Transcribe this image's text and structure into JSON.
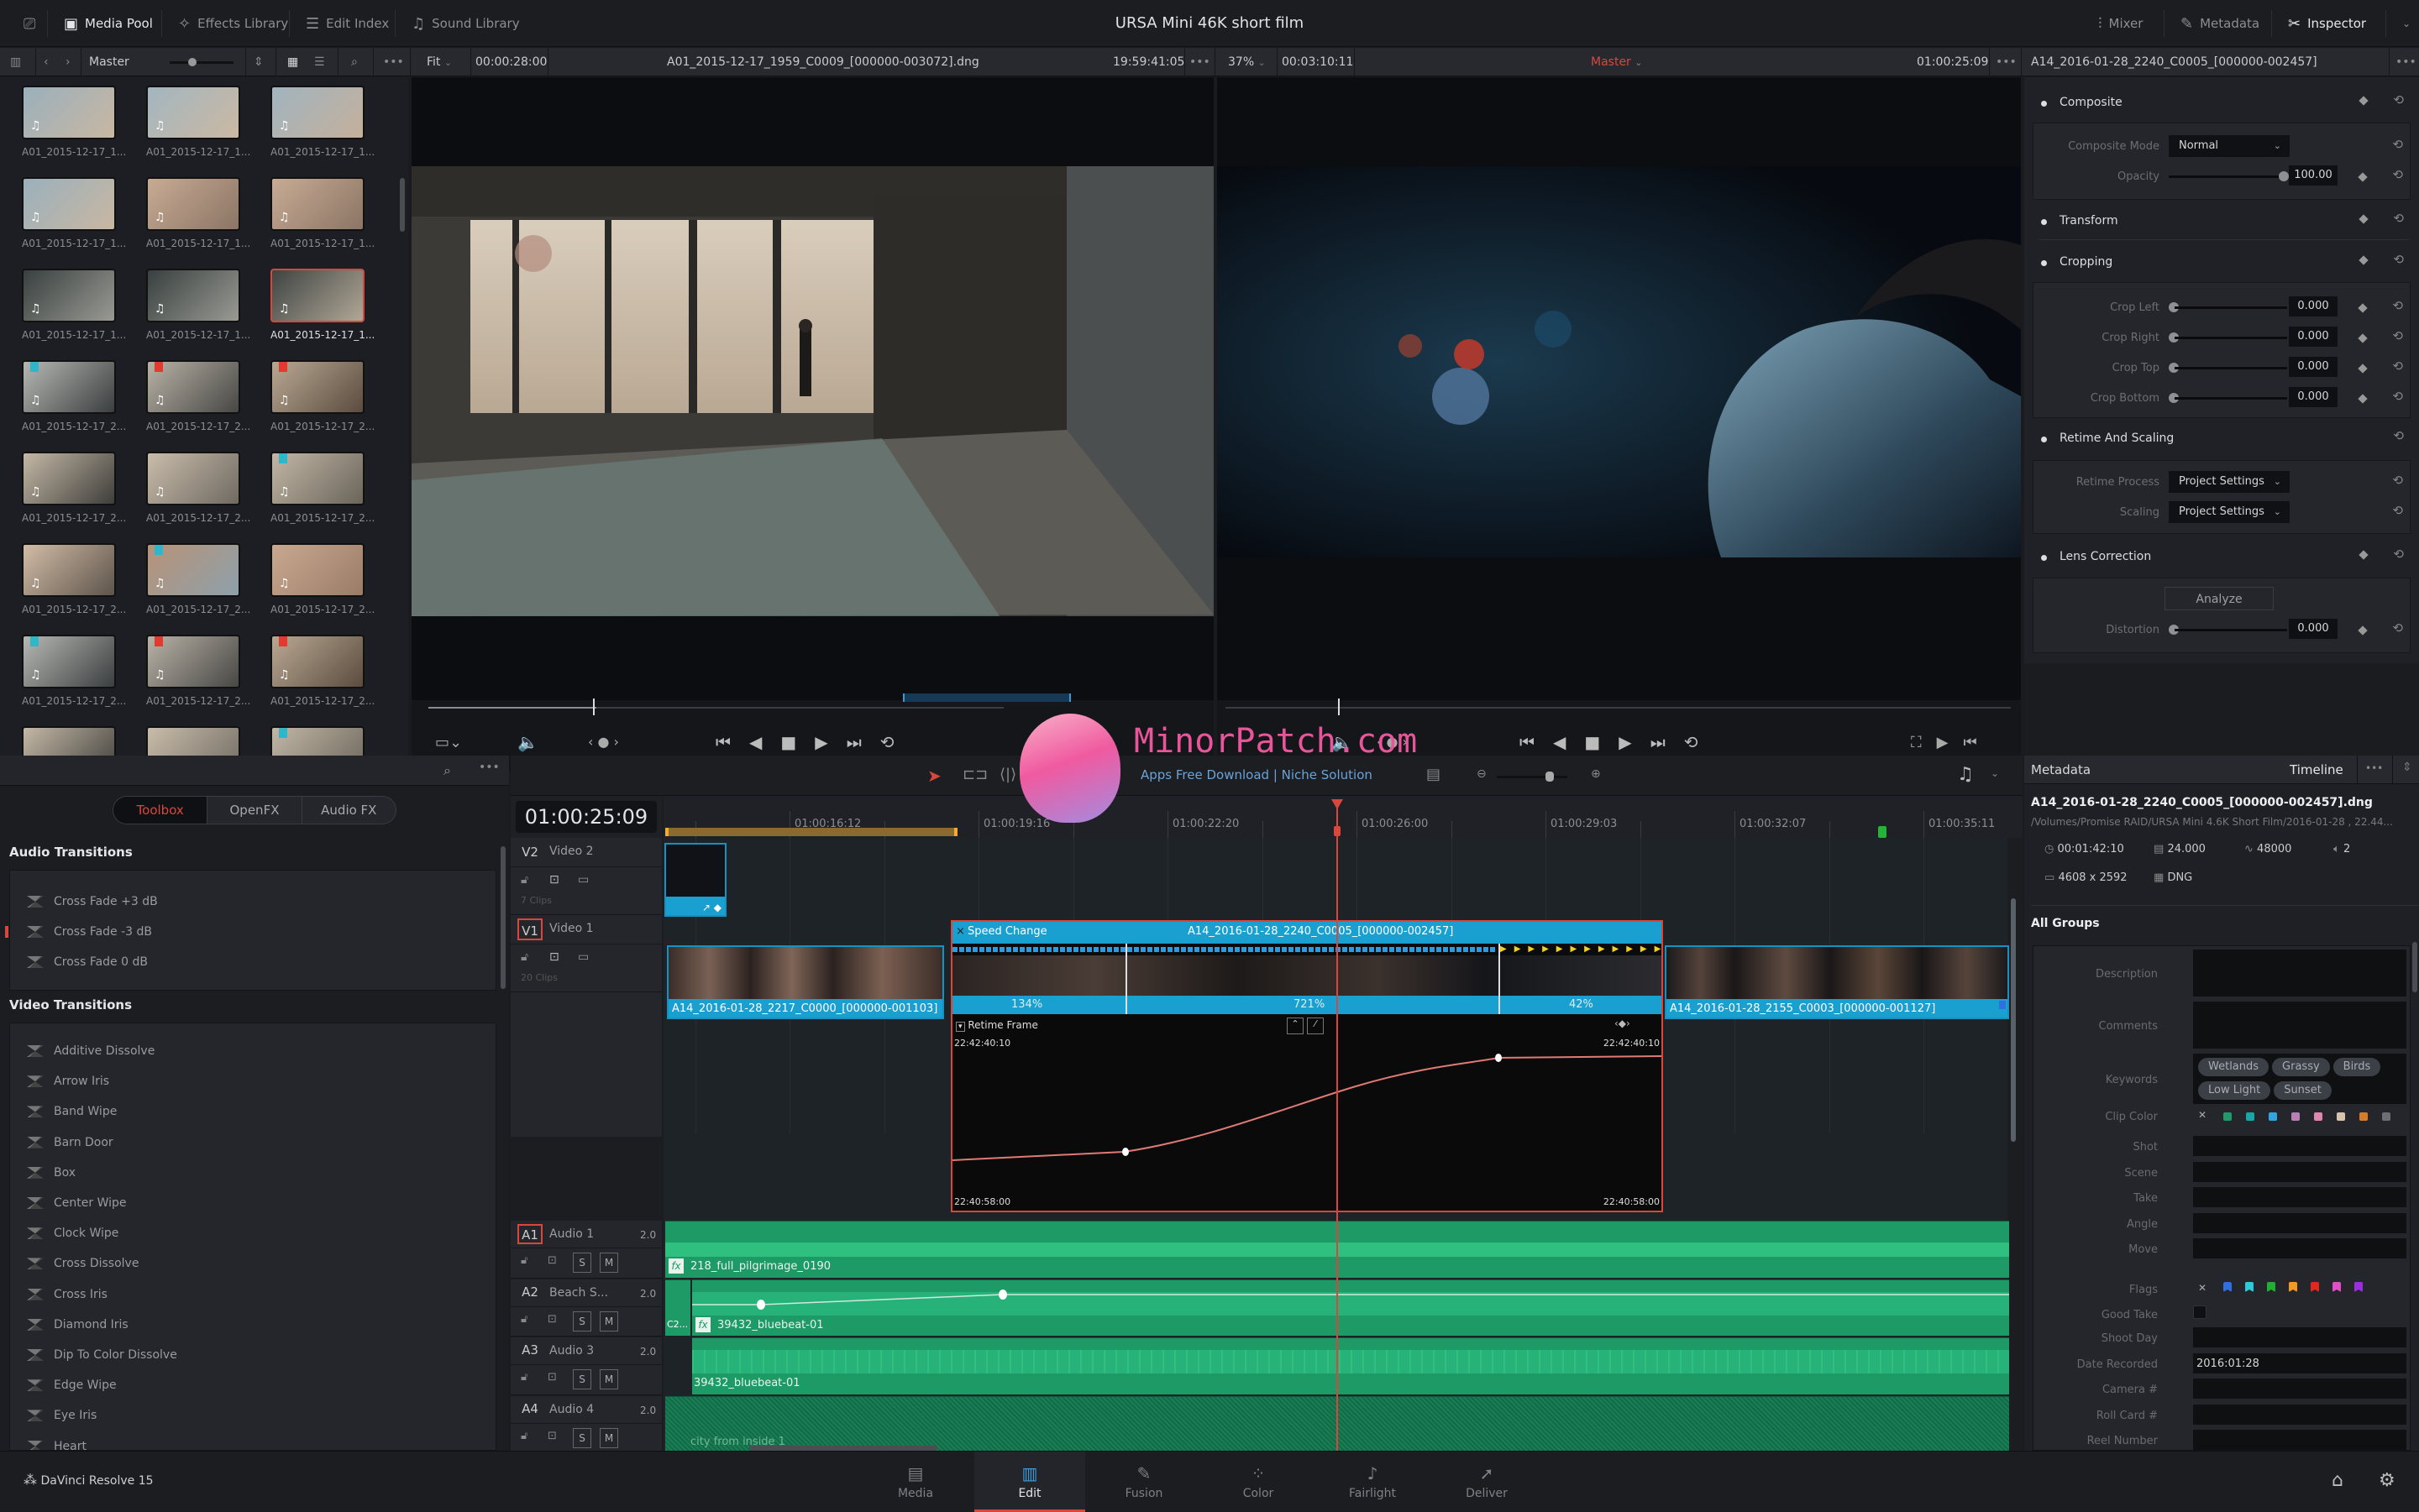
{
  "app": {
    "project_title": "URSA Mini 46K short film",
    "product_name": "DaVinci Resolve 15"
  },
  "topbar": {
    "left_buttons": [
      {
        "label": "Media Pool",
        "icon": "media-pool-icon",
        "active": true
      },
      {
        "label": "Effects Library",
        "icon": "effects-wand-icon",
        "active": false
      },
      {
        "label": "Edit Index",
        "icon": "list-icon",
        "active": false
      },
      {
        "label": "Sound Library",
        "icon": "sound-library-icon",
        "active": false
      }
    ],
    "right_buttons": [
      {
        "label": "Mixer",
        "icon": "mixer-icon",
        "active": false
      },
      {
        "label": "Metadata",
        "icon": "metadata-icon",
        "active": false
      },
      {
        "label": "Inspector",
        "icon": "inspector-icon",
        "active": true
      }
    ]
  },
  "mediapool": {
    "bin": "Master",
    "clips": [
      {
        "name": "A01_2015-12-17_1...",
        "flag": null,
        "selected": false,
        "tone": [
          "#9ab0bc",
          "#c9b7a2"
        ]
      },
      {
        "name": "A01_2015-12-17_1...",
        "flag": null,
        "selected": false,
        "tone": [
          "#a3b6c0",
          "#cbb8a2"
        ]
      },
      {
        "name": "A01_2015-12-17_1...",
        "flag": null,
        "selected": false,
        "tone": [
          "#a1b4bf",
          "#c5b09b"
        ]
      },
      {
        "name": "A01_2015-12-17_1...",
        "flag": null,
        "selected": false,
        "tone": [
          "#9ab0bc",
          "#c9b7a2"
        ]
      },
      {
        "name": "A01_2015-12-17_1...",
        "flag": null,
        "selected": false,
        "tone": [
          "#c7ab94",
          "#8c7565"
        ]
      },
      {
        "name": "A01_2015-12-17_1...",
        "flag": null,
        "selected": false,
        "tone": [
          "#c7ab94",
          "#8c7565"
        ]
      },
      {
        "name": "A01_2015-12-17_1...",
        "flag": null,
        "selected": false,
        "tone": [
          "#38403f",
          "#9a9a94"
        ]
      },
      {
        "name": "A01_2015-12-17_1...",
        "flag": null,
        "selected": false,
        "tone": [
          "#38403f",
          "#9a9a94"
        ]
      },
      {
        "name": "A01_2015-12-17_1...",
        "flag": null,
        "selected": true,
        "tone": [
          "#3e4443",
          "#b1a796"
        ]
      },
      {
        "name": "A01_2015-12-17_2...",
        "flag": "#2fb7c9",
        "selected": false,
        "tone": [
          "#b7b8b4",
          "#3b3e3f"
        ]
      },
      {
        "name": "A01_2015-12-17_2...",
        "flag": "#e23a2e",
        "selected": false,
        "tone": [
          "#b9b2a6",
          "#474745"
        ]
      },
      {
        "name": "A01_2015-12-17_2...",
        "flag": "#e23a2e",
        "selected": false,
        "tone": [
          "#b8a892",
          "#5c4c40"
        ]
      },
      {
        "name": "A01_2015-12-17_2...",
        "flag": null,
        "selected": false,
        "tone": [
          "#c4b8a6",
          "#3f3e3b"
        ]
      },
      {
        "name": "A01_2015-12-17_2...",
        "flag": null,
        "selected": false,
        "tone": [
          "#c9bcaa",
          "#6f6a62"
        ]
      },
      {
        "name": "A01_2015-12-17_2...",
        "flag": "#2fb7c9",
        "selected": false,
        "tone": [
          "#c2b7a6",
          "#6a645a"
        ]
      },
      {
        "name": "A01_2015-12-17_2...",
        "flag": null,
        "selected": false,
        "tone": [
          "#d2bca6",
          "#5d544b"
        ]
      },
      {
        "name": "A01_2015-12-17_2...",
        "flag": "#2fb7c9",
        "selected": false,
        "tone": [
          "#b89378",
          "#8da0ab"
        ]
      },
      {
        "name": "A01_2015-12-17_2...",
        "flag": null,
        "selected": false,
        "tone": [
          "#c9a891",
          "#9a7c66"
        ]
      },
      {
        "name": "A01_2015-12-17_2...",
        "flag": "#2fb7c9",
        "selected": false,
        "tone": [
          "#b7b8b4",
          "#3b3e3f"
        ]
      },
      {
        "name": "A01_2015-12-17_2...",
        "flag": "#e23a2e",
        "selected": false,
        "tone": [
          "#b9b2a6",
          "#474745"
        ]
      },
      {
        "name": "A01_2015-12-17_2...",
        "flag": "#e23a2e",
        "selected": false,
        "tone": [
          "#b8a892",
          "#5c4c40"
        ]
      },
      {
        "name": "",
        "flag": null,
        "selected": false,
        "tone": [
          "#c4b8a6",
          "#3f3e3b"
        ]
      },
      {
        "name": "",
        "flag": null,
        "selected": false,
        "tone": [
          "#c9bcaa",
          "#6f6a62"
        ]
      },
      {
        "name": "",
        "flag": "#2fb7c9",
        "selected": false,
        "tone": [
          "#c2b7a6",
          "#6a645a"
        ]
      }
    ]
  },
  "source_viewer": {
    "zoom": "Fit",
    "duration": "00:00:28:00",
    "clip_name": "A01_2015-12-17_1959_C0009_[000000-003072].dng",
    "timecode": "19:59:41:05"
  },
  "timeline_viewer": {
    "zoom": "37%",
    "duration": "00:03:10:11",
    "timeline_name": "Master",
    "timecode": "01:00:25:09"
  },
  "inspector": {
    "clip_name": "A14_2016-01-28_2240_C0005_[000000-002457]",
    "sections": {
      "composite": {
        "title": "Composite",
        "mode_label": "Composite Mode",
        "mode_value": "Normal",
        "opacity_label": "Opacity",
        "opacity_value": "100.00",
        "opacity_fraction": 1.0
      },
      "transform": {
        "title": "Transform"
      },
      "cropping": {
        "title": "Cropping",
        "fields": [
          {
            "label": "Crop Left",
            "value": "0.000"
          },
          {
            "label": "Crop Right",
            "value": "0.000"
          },
          {
            "label": "Crop Top",
            "value": "0.000"
          },
          {
            "label": "Crop Bottom",
            "value": "0.000"
          }
        ]
      },
      "retime": {
        "title": "Retime And Scaling",
        "process_label": "Retime Process",
        "process_value": "Project Settings",
        "scaling_label": "Scaling",
        "scaling_value": "Project Settings"
      },
      "lens": {
        "title": "Lens Correction",
        "analyze_label": "Analyze",
        "distortion_label": "Distortion",
        "distortion_value": "0.000"
      }
    }
  },
  "effects": {
    "tabs": [
      {
        "label": "Toolbox",
        "active": true
      },
      {
        "label": "OpenFX",
        "active": false
      },
      {
        "label": "Audio FX",
        "active": false
      }
    ],
    "audio_title": "Audio Transitions",
    "audio_items": [
      {
        "label": "Cross Fade +3 dB",
        "marked": false
      },
      {
        "label": "Cross Fade -3 dB",
        "marked": true
      },
      {
        "label": "Cross Fade 0 dB",
        "marked": false
      }
    ],
    "video_title": "Video Transitions",
    "video_items": [
      {
        "label": "Additive Dissolve",
        "marked": false
      },
      {
        "label": "Arrow Iris",
        "marked": false
      },
      {
        "label": "Band Wipe",
        "marked": false
      },
      {
        "label": "Barn Door",
        "marked": false
      },
      {
        "label": "Box",
        "marked": false
      },
      {
        "label": "Center Wipe",
        "marked": false
      },
      {
        "label": "Clock Wipe",
        "marked": false
      },
      {
        "label": "Cross Dissolve",
        "marked": true
      },
      {
        "label": "Cross Iris",
        "marked": false
      },
      {
        "label": "Diamond Iris",
        "marked": false
      },
      {
        "label": "Dip To Color Dissolve",
        "marked": false
      },
      {
        "label": "Edge Wipe",
        "marked": false
      },
      {
        "label": "Eye Iris",
        "marked": false
      },
      {
        "label": "Heart",
        "marked": false
      }
    ]
  },
  "timeline": {
    "timecode": "01:00:25:09",
    "ruler": [
      "01:00:16:12",
      "01:00:19:16",
      "01:00:22:20",
      "01:00:26:00",
      "01:00:29:03",
      "01:00:32:07",
      "01:00:35:11"
    ],
    "video_tracks": [
      {
        "id": "V2",
        "name": "Video 2",
        "clips_count": "7 Clips",
        "active": false
      },
      {
        "id": "V1",
        "name": "Video 1",
        "clips_count": "20 Clips",
        "active": true
      }
    ],
    "v1_clips": {
      "left": "A14_2016-01-28_2217_C0000_[000000-001103]",
      "center_header": "Speed Change",
      "center_name": "A14_2016-01-28_2240_C0005_[000000-002457]",
      "right": "A14_2016-01-28_2155_C0003_[000000-001127]",
      "speeds": [
        "134%",
        "721%",
        "42%"
      ]
    },
    "retime_curve": {
      "title": "Retime Frame",
      "top_left": "22:42:40:10",
      "top_right": "22:42:40:10",
      "bottom_left": "22:40:58:00",
      "bottom_right": "22:40:58:00"
    },
    "audio_tracks": [
      {
        "id": "A1",
        "name": "Audio 1",
        "channels": "2.0",
        "clip": "218_full_pilgrimage_0190",
        "active": true
      },
      {
        "id": "A2",
        "name": "Beach S...",
        "channels": "2.0",
        "clip": "39432_bluebeat-01",
        "prefix": "C2...",
        "active": false
      },
      {
        "id": "A3",
        "name": "Audio 3",
        "channels": "2.0",
        "clip": "39432_bluebeat-01",
        "active": false
      },
      {
        "id": "A4",
        "name": "Audio 4",
        "channels": "2.0",
        "clip": "city from inside 1",
        "active": false
      }
    ],
    "solo_label": "S",
    "mute_label": "M"
  },
  "metadata": {
    "title": "Metadata",
    "scope": "Timeline",
    "file_name": "A14_2016-01-28_2240_C0005_[000000-002457].dng",
    "path": "/Volumes/Promise RAID/URSA Mini 4.6K Short Film/2016-01-28 , 22.44...",
    "duration": "00:01:42:10",
    "fps": "24.000",
    "sample_rate": "48000",
    "audio_channels": "2",
    "resolution": "4608 x 2592",
    "codec": "DNG",
    "group_title": "All Groups",
    "labels": {
      "description": "Description",
      "comments": "Comments",
      "keywords": "Keywords",
      "clip_color": "Clip Color",
      "shot": "Shot",
      "scene": "Scene",
      "take": "Take",
      "angle": "Angle",
      "move": "Move",
      "flags": "Flags",
      "good_take": "Good Take",
      "shoot_day": "Shoot Day",
      "date_recorded": "Date Recorded",
      "camera": "Camera #",
      "roll_card": "Roll Card #",
      "reel_number": "Reel Number"
    },
    "keywords": [
      "Wetlands",
      "Grassy",
      "Birds",
      "Low Light",
      "Sunset"
    ],
    "clip_colors": [
      "#1f9a6b",
      "#1aa6a6",
      "#2fa6e0",
      "#b67fb6",
      "#e383b0",
      "#d6c3ac",
      "#d97c26",
      "#6e6f72"
    ],
    "flag_colors": [
      "#2f6fe0",
      "#2ccbd9",
      "#22b032",
      "#f29a21",
      "#e0281f",
      "#e04fc5",
      "#9b2fe0"
    ],
    "date_recorded": "2016:01:28"
  },
  "pages": [
    {
      "label": "Media",
      "icon": "media-page-icon",
      "active": false
    },
    {
      "label": "Edit",
      "icon": "edit-page-icon",
      "active": true
    },
    {
      "label": "Fusion",
      "icon": "fusion-page-icon",
      "active": false
    },
    {
      "label": "Color",
      "icon": "color-page-icon",
      "active": false
    },
    {
      "label": "Fairlight",
      "icon": "fairlight-page-icon",
      "active": false
    },
    {
      "label": "Deliver",
      "icon": "deliver-page-icon",
      "active": false
    }
  ],
  "watermark": {
    "title": "MinorPatch.com",
    "subtitle": "Apps Free Download | Niche Solution"
  },
  "colors": {
    "accent_red": "#d9473c",
    "clip_blue": "#1aa0d0",
    "audio_green": "#1e9a66"
  }
}
